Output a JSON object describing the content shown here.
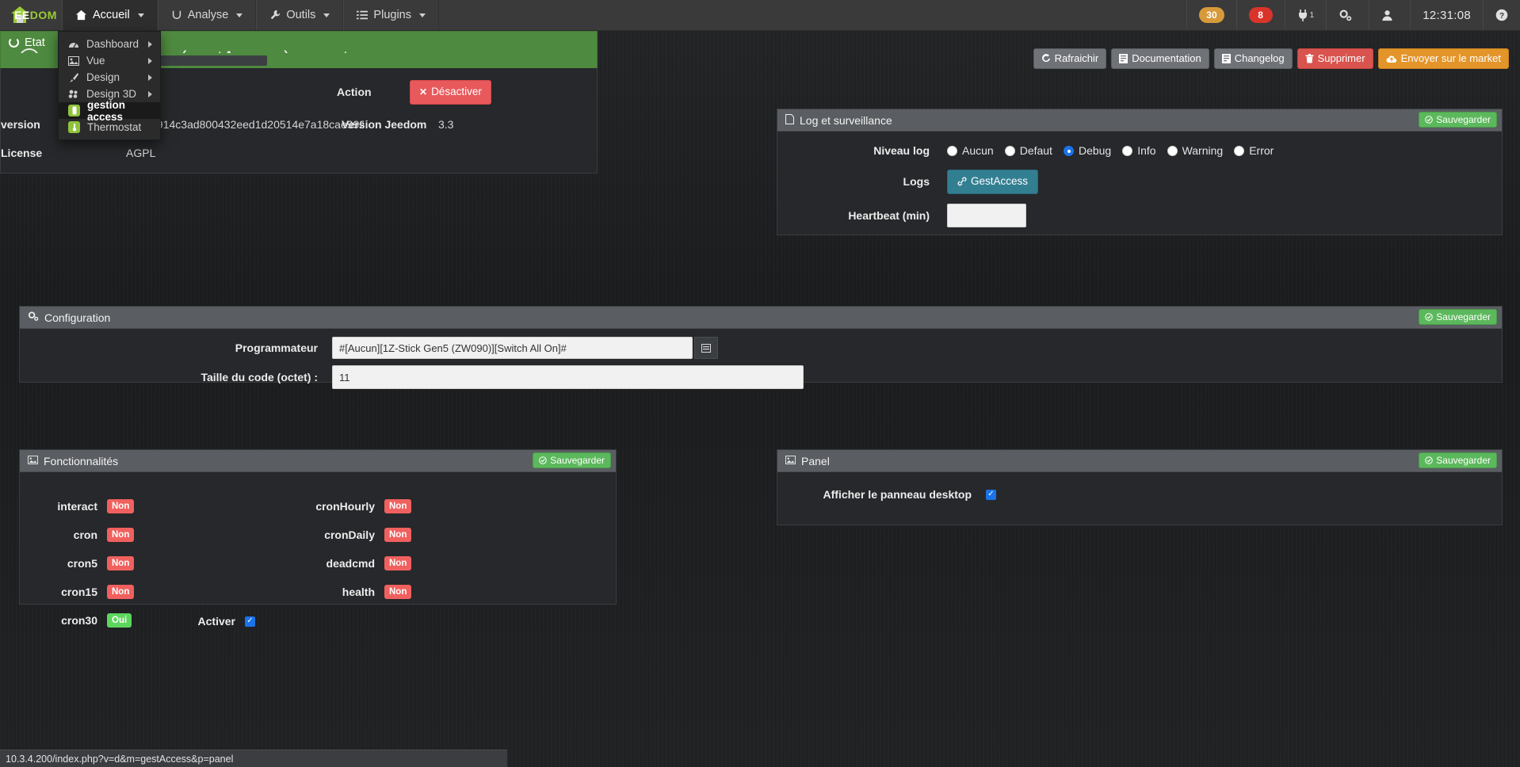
{
  "topnav": {
    "brand": {
      "text_ee": "EE",
      "text_dom": "DOM",
      "icon": "house-icon"
    },
    "items": [
      {
        "label": "Accueil",
        "icon": "home-icon",
        "active": true,
        "caret": true
      },
      {
        "label": "Analyse",
        "icon": "analysis-icon",
        "active": false,
        "caret": true
      },
      {
        "label": "Outils",
        "icon": "wrench-icon",
        "active": false,
        "caret": true
      },
      {
        "label": "Plugins",
        "icon": "list-icon",
        "active": false,
        "caret": true
      }
    ],
    "right": {
      "badge_orange": "30",
      "badge_red": "8",
      "plug_count": "1",
      "plug_icon": "plug-icon",
      "gear_icon": "gear-icon",
      "user_icon": "user-icon",
      "clock": "12:31:08",
      "help_icon": "help-circle-icon"
    }
  },
  "accueil_menu": {
    "items": [
      {
        "label": "Dashboard",
        "icon": "dashboard-icon",
        "submenu": true,
        "selected": false
      },
      {
        "label": "Vue",
        "icon": "image-icon",
        "submenu": true,
        "selected": false
      },
      {
        "label": "Design",
        "icon": "brush-icon",
        "submenu": true,
        "selected": false
      },
      {
        "label": "Design 3D",
        "icon": "cubes-icon",
        "submenu": true,
        "selected": false
      },
      {
        "label": "gestion access",
        "icon": "plugin-icon",
        "submenu": false,
        "selected": true
      },
      {
        "label": "Thermostat",
        "icon": "thermometer-icon",
        "submenu": false,
        "selected": false
      }
    ]
  },
  "page": {
    "back_icon": "back-arrow-icon",
    "title": "gestion access (gestAccess) - master",
    "head_buttons": [
      {
        "label": "Rafraichir",
        "icon": "refresh-icon",
        "style": "grey"
      },
      {
        "label": "Documentation",
        "icon": "book-icon",
        "style": "grey"
      },
      {
        "label": "Changelog",
        "icon": "book-icon",
        "style": "grey"
      },
      {
        "label": "Supprimer",
        "icon": "trash-icon",
        "style": "red"
      },
      {
        "label": "Envoyer sur le market",
        "icon": "cloud-upload-icon",
        "style": "orange"
      }
    ]
  },
  "etat": {
    "title": "Etat",
    "title_icon": "spinner-icon",
    "action_label": "Action",
    "action_button": "Désactiver",
    "action_button_icon": "x-icon",
    "version_label": "version",
    "version_value": "14446914c3ad800432eed1d20514e7a18cae9924",
    "jeedom_label": "Version Jeedom",
    "jeedom_value": "3.3",
    "license_label": "License",
    "license_value": "AGPL"
  },
  "log": {
    "title": "Log et surveillance",
    "title_icon": "file-icon",
    "save_label": "Sauvegarder",
    "save_icon": "check-circle-icon",
    "niveau_label": "Niveau log",
    "levels": [
      {
        "label": "Aucun",
        "selected": false
      },
      {
        "label": "Defaut",
        "selected": false
      },
      {
        "label": "Debug",
        "selected": true
      },
      {
        "label": "Info",
        "selected": false
      },
      {
        "label": "Warning",
        "selected": false
      },
      {
        "label": "Error",
        "selected": false
      }
    ],
    "logs_label": "Logs",
    "logs_button": "GestAccess",
    "logs_button_icon": "link-icon",
    "heartbeat_label": "Heartbeat (min)",
    "heartbeat_value": "",
    "heartbeat_placeholder": ""
  },
  "configuration": {
    "title": "Configuration",
    "title_icon": "gears-icon",
    "save_label": "Sauvegarder",
    "save_icon": "check-circle-icon",
    "programmateur_label": "Programmateur",
    "programmateur_value": "#[Aucun][1Z-Stick Gen5 (ZW090)][Switch All On]#",
    "programmateur_btn_icon": "list-picker-icon",
    "taille_label": "Taille du code (octet) :",
    "taille_value": "11"
  },
  "fonctionnalites": {
    "title": "Fonctionnalités",
    "title_icon": "image-icon",
    "save_label": "Sauvegarder",
    "save_icon": "check-circle-icon",
    "left": [
      {
        "label": "interact",
        "value": "Non",
        "state": "non"
      },
      {
        "label": "cron",
        "value": "Non",
        "state": "non"
      },
      {
        "label": "cron5",
        "value": "Non",
        "state": "non"
      },
      {
        "label": "cron15",
        "value": "Non",
        "state": "non"
      },
      {
        "label": "cron30",
        "value": "Oui",
        "state": "oui"
      }
    ],
    "right": [
      {
        "label": "cronHourly",
        "value": "Non",
        "state": "non"
      },
      {
        "label": "cronDaily",
        "value": "Non",
        "state": "non"
      },
      {
        "label": "deadcmd",
        "value": "Non",
        "state": "non"
      },
      {
        "label": "health",
        "value": "Non",
        "state": "non"
      }
    ],
    "activer_label": "Activer",
    "activer_checked": true
  },
  "panel": {
    "title": "Panel",
    "title_icon": "image-icon",
    "save_label": "Sauvegarder",
    "save_icon": "check-circle-icon",
    "desktop_label": "Afficher le panneau desktop",
    "desktop_checked": true
  },
  "statusbar": {
    "url": "10.3.4.200/index.php?v=d&m=gestAccess&p=panel"
  },
  "colors": {
    "nav_bg": "#3a3a3a",
    "panel_head": "#5a5d61",
    "panel_bg": "#26282b",
    "green": "#5cb85c",
    "etat_green": "#4e8a3f",
    "red_badge": "#f0605e",
    "green_badge": "#5cd65c",
    "accent_blue": "#1a73e8",
    "orange": "#e3952a",
    "teal": "#337f92"
  }
}
